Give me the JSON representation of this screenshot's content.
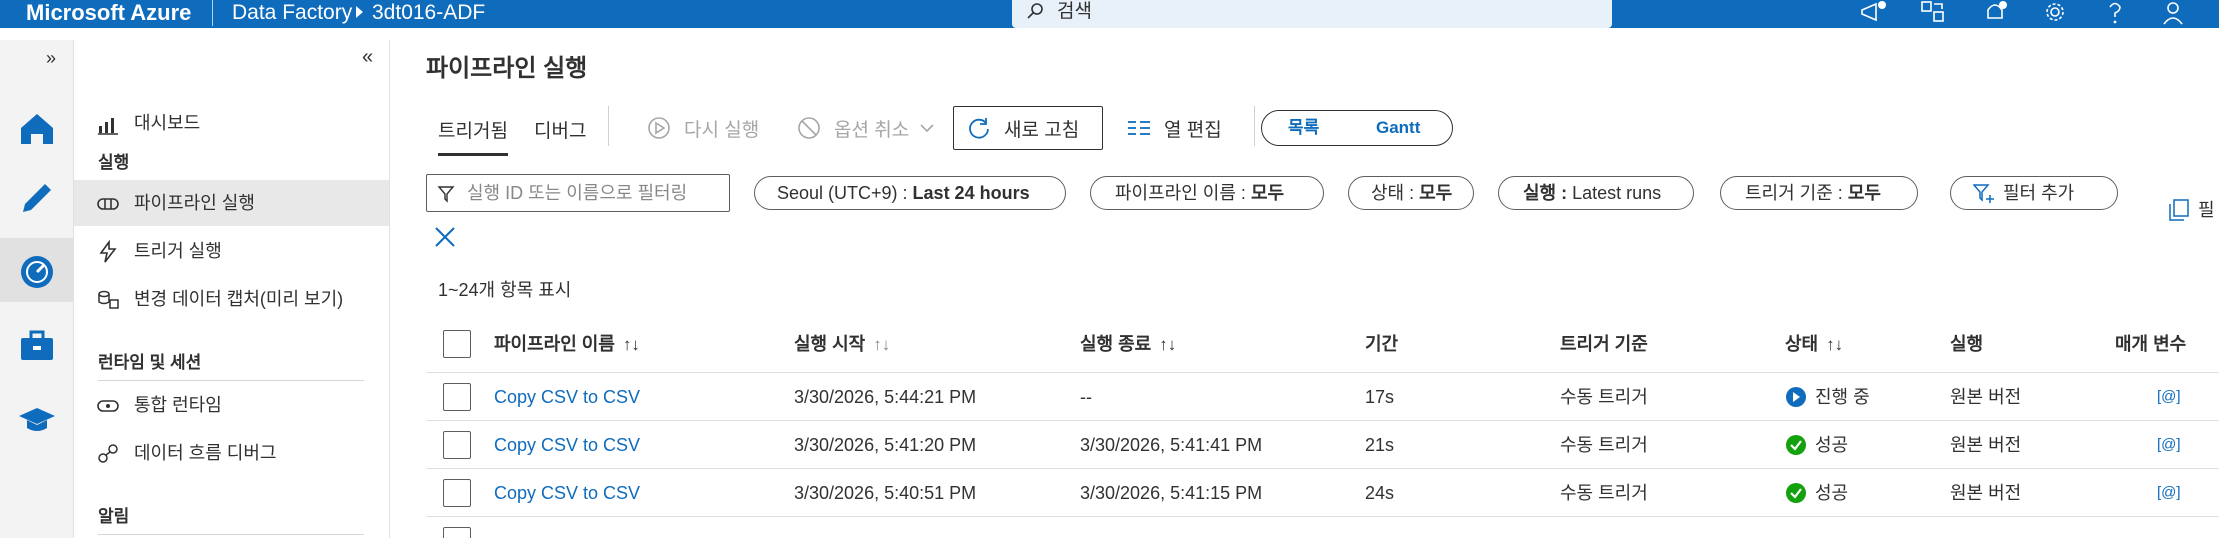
{
  "topbar": {
    "brand": "Microsoft Azure",
    "breadcrumb": [
      "Data Factory",
      "3dt016-ADF"
    ],
    "search_placeholder": "검색"
  },
  "nav": {
    "items": [
      {
        "label": "대시보드",
        "icon": "dashboard-icon"
      },
      {
        "label": "파이프라인 실행",
        "icon": "pipeline-runs-icon",
        "active": true
      },
      {
        "label": "트리거 실행",
        "icon": "trigger-icon"
      },
      {
        "label": "변경 데이터 캡처(미리 보기)",
        "icon": "cdc-icon"
      },
      {
        "label": "통합 런타임",
        "icon": "runtime-icon"
      },
      {
        "label": "데이터 흐름 디버그",
        "icon": "dataflow-debug-icon"
      }
    ],
    "sections": [
      "실행",
      "런타임 및 세션",
      "알림"
    ]
  },
  "page": {
    "title": "파이프라인 실행",
    "tabs": [
      "트리거됨",
      "디버그"
    ],
    "toolbar": {
      "rerun": "다시 실행",
      "cancel": "옵션 취소",
      "refresh": "새로 고침",
      "edit_columns": "열 편집"
    },
    "view_toggle": [
      "목록",
      "Gantt"
    ]
  },
  "filters": {
    "search_placeholder": "실행 ID 또는 이름으로 필터링",
    "pills": [
      {
        "label": "Seoul (UTC+9) : ",
        "value": "Last 24 hours"
      },
      {
        "label": "파이프라인 이름 : ",
        "value": "모두"
      },
      {
        "label": "상태 : ",
        "value": "모두"
      },
      {
        "label": "실행 : ",
        "value": "Latest runs",
        "bold_label": true
      },
      {
        "label": "트리거 기준 : ",
        "value": "모두"
      }
    ],
    "add_filter": "필터 추가",
    "cut_off_label": "필"
  },
  "count_text": "1~24개 항목 표시",
  "table": {
    "headers": [
      "파이프라인 이름",
      "실행 시작",
      "실행 종료",
      "기간",
      "트리거 기준",
      "상태",
      "실행",
      "매개 변수"
    ],
    "sort_glyph": "↑↓",
    "rows": [
      {
        "name": "Copy CSV to CSV",
        "start": "3/30/2026, 5:44:21 PM",
        "end": "--",
        "duration": "17s",
        "trigger": "수동 트리거",
        "status": "진행 중",
        "status_kind": "running",
        "run": "원본 버전",
        "params": "[@]"
      },
      {
        "name": "Copy CSV to CSV",
        "start": "3/30/2026, 5:41:20 PM",
        "end": "3/30/2026, 5:41:41 PM",
        "duration": "21s",
        "trigger": "수동 트리거",
        "status": "성공",
        "status_kind": "success",
        "run": "원본 버전",
        "params": "[@]"
      },
      {
        "name": "Copy CSV to CSV",
        "start": "3/30/2026, 5:40:51 PM",
        "end": "3/30/2026, 5:41:15 PM",
        "duration": "24s",
        "trigger": "수동 트리거",
        "status": "성공",
        "status_kind": "success",
        "run": "원본 버전",
        "params": "[@]"
      }
    ]
  },
  "colors": {
    "accent": "#0f6cbd",
    "success": "#13a10e"
  }
}
